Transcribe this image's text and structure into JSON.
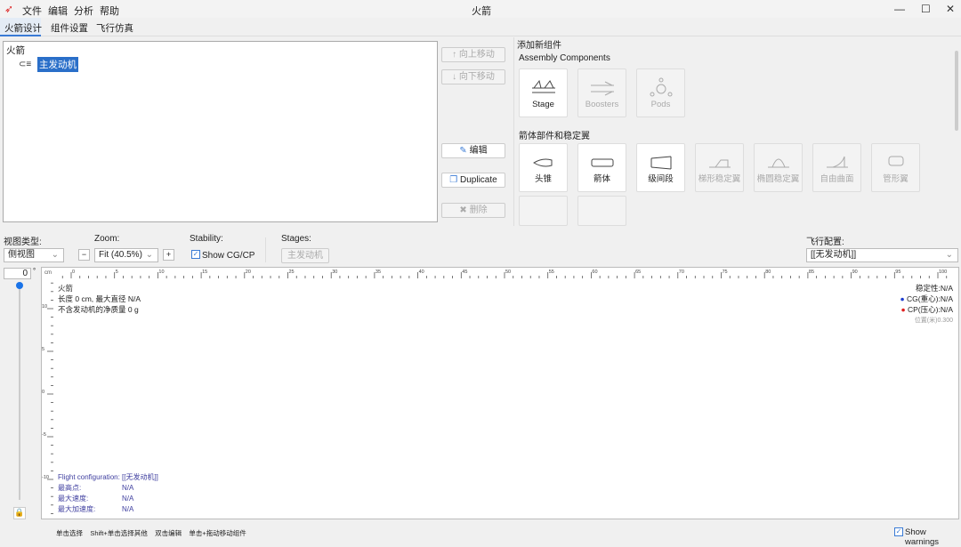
{
  "window": {
    "title": "火箭",
    "controls": [
      "—",
      "☐",
      "✕"
    ]
  },
  "menu": [
    "文件",
    "编辑",
    "分析",
    "帮助"
  ],
  "tabs": [
    "火箭设计",
    "组件设置",
    "飞行仿真"
  ],
  "tree": {
    "root": "火箭",
    "child": "主发动机"
  },
  "actions": {
    "move_up": "向上移动",
    "move_down": "向下移动",
    "edit": "编辑",
    "duplicate": "Duplicate",
    "delete": "删除"
  },
  "palette": {
    "title": "添加新组件",
    "assembly_title": "Assembly Components",
    "assembly": [
      "Stage",
      "Boosters",
      "Pods"
    ],
    "body_title": "箭体部件和稳定翼",
    "body": [
      "头锥",
      "箭体",
      "级间段",
      "梯形稳定翼",
      "椭圆稳定翼",
      "自由曲面",
      "管形翼"
    ]
  },
  "view": {
    "type_label": "视图类型:",
    "type_value": "侧视图",
    "zoom_label": "Zoom:",
    "zoom_value": "Fit (40.5%)",
    "stability_label": "Stability:",
    "show_cgcp": "Show CG/CP",
    "stages_label": "Stages:",
    "stage_button": "主发动机",
    "flight_config_label": "飞行配置:",
    "flight_config_value": "[[无发动机]]",
    "rotation": "0",
    "rotation_unit": "°"
  },
  "ruler": {
    "unit": "cm",
    "x_labels": [
      0,
      5,
      10,
      15,
      20,
      25,
      30,
      35,
      40,
      45,
      50,
      55,
      60,
      65,
      70,
      75,
      80,
      85,
      90,
      95,
      100
    ],
    "y_labels": [
      10,
      5,
      0,
      -5,
      -10
    ]
  },
  "info": {
    "name": "火箭",
    "length": "长度 0 cm, 最大直径 N/A",
    "mass": "不含发动机的净质量 0 g",
    "stability": "稳定性:N/A",
    "cg": "CG(重心):N/A",
    "cp": "CP(压心):N/A",
    "position": "位置(米)0.300"
  },
  "flight": {
    "config_label": "Flight configuration:",
    "config_value": "[[无发动机]]",
    "rows": [
      {
        "label": "最高点:",
        "value": "N/A"
      },
      {
        "label": "最大速度:",
        "value": "N/A"
      },
      {
        "label": "最大加速度:",
        "value": "N/A"
      }
    ]
  },
  "status": {
    "hints": [
      "单击选择",
      "Shift+单击选择其他",
      "双击编辑",
      "单击+拖动移动组件"
    ],
    "show_warnings": "Show warnings"
  },
  "colors": {
    "selection": "#2a6fc9",
    "cg": "#1f3fd0",
    "cp": "#e02020"
  }
}
